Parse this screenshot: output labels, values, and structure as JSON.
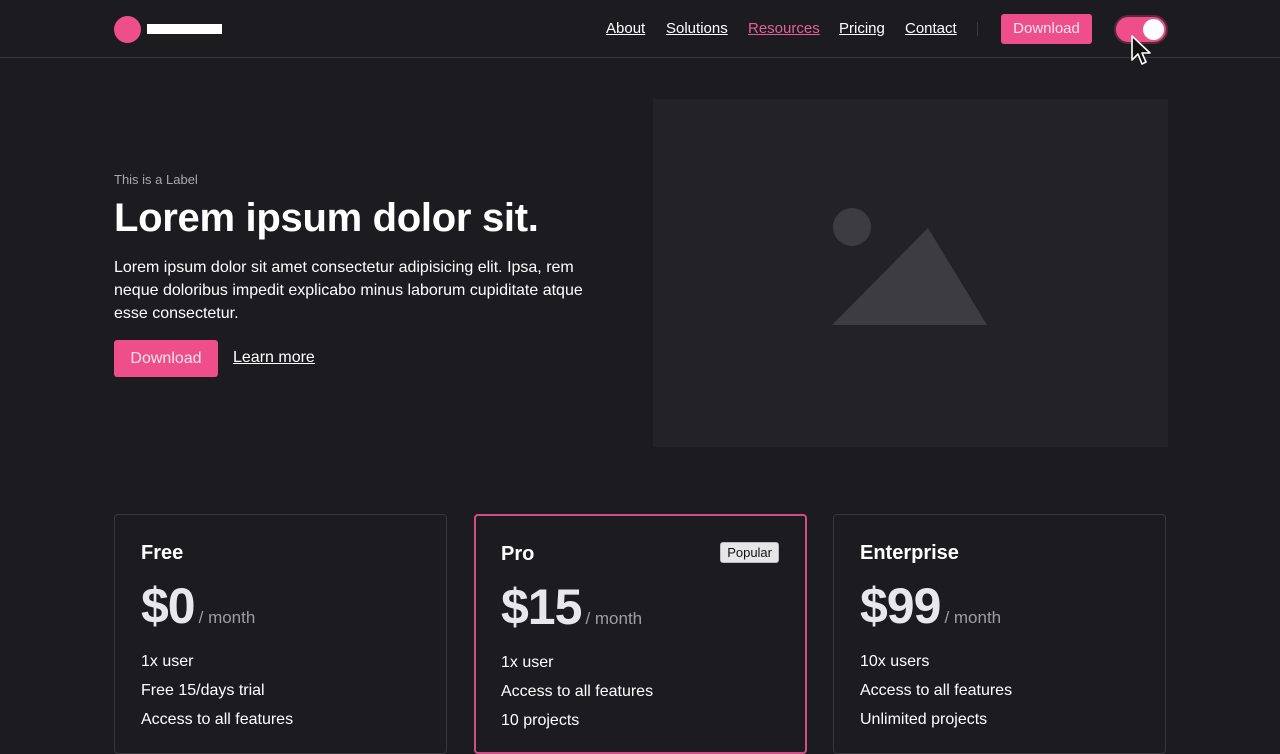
{
  "header": {
    "nav": [
      {
        "label": "About",
        "active": false
      },
      {
        "label": "Solutions",
        "active": false
      },
      {
        "label": "Resources",
        "active": true
      },
      {
        "label": "Pricing",
        "active": false
      },
      {
        "label": "Contact",
        "active": false
      }
    ],
    "download_label": "Download",
    "theme_toggle_on": true
  },
  "hero": {
    "label": "This is a Label",
    "title": "Lorem ipsum dolor sit.",
    "text": "Lorem ipsum dolor sit amet consectetur adipisicing elit. Ipsa, rem neque doloribus impedit explicabo minus laborum cupiditate atque esse consectetur.",
    "download_label": "Download",
    "learn_more_label": "Learn more",
    "image_icon": "image-placeholder-icon"
  },
  "pricing": {
    "plans": [
      {
        "name": "Free",
        "price": "$0",
        "period": "/ month",
        "badge": null,
        "features": [
          "1x user",
          "Free 15/days trial",
          "Access to all features"
        ]
      },
      {
        "name": "Pro",
        "price": "$15",
        "period": "/ month",
        "badge": "Popular",
        "features": [
          "1x user",
          "Access to all features",
          "10 projects"
        ]
      },
      {
        "name": "Enterprise",
        "price": "$99",
        "period": "/ month",
        "badge": null,
        "features": [
          "10x users",
          "Access to all features",
          "Unlimited projects"
        ]
      }
    ]
  },
  "colors": {
    "accent": "#ee4f8b",
    "background": "#1c1b20",
    "active_link": "#e3609a"
  }
}
